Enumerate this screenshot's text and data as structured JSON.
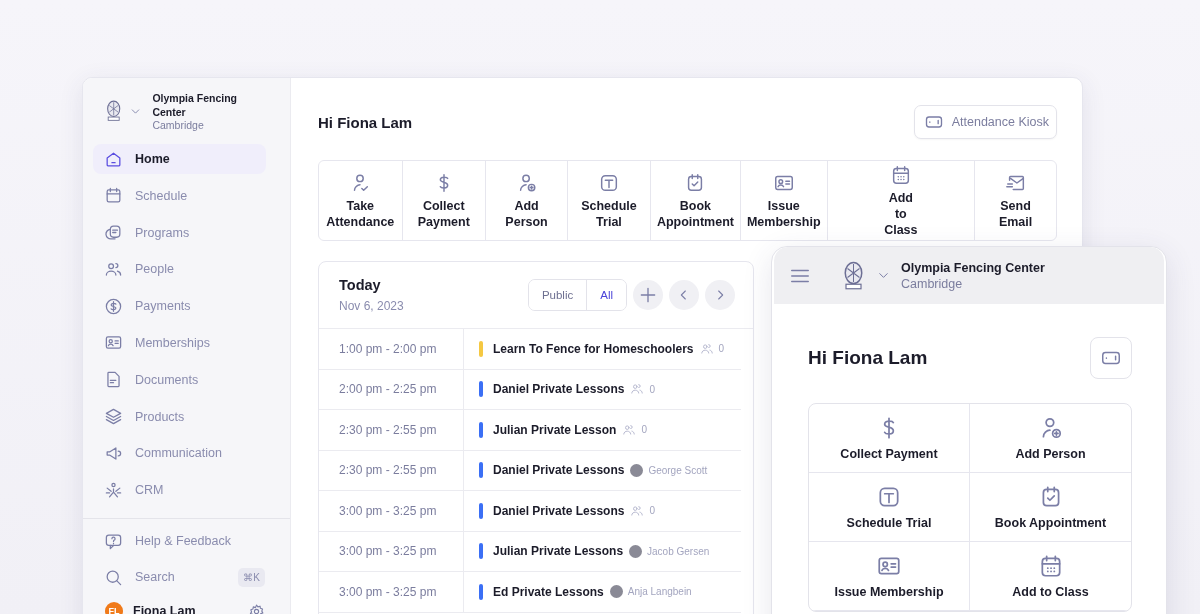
{
  "desktop": {
    "org": {
      "name": "Olympia Fencing Center",
      "location": "Cambridge"
    },
    "nav": [
      {
        "label": "Home",
        "selected": true
      },
      {
        "label": "Schedule",
        "selected": false
      },
      {
        "label": "Programs",
        "selected": false
      },
      {
        "label": "People",
        "selected": false
      },
      {
        "label": "Payments",
        "selected": false
      },
      {
        "label": "Memberships",
        "selected": false
      },
      {
        "label": "Documents",
        "selected": false
      },
      {
        "label": "Products",
        "selected": false
      },
      {
        "label": "Communication",
        "selected": false
      },
      {
        "label": "CRM",
        "selected": false
      }
    ],
    "footer_nav": [
      {
        "label": "Help & Feedback"
      },
      {
        "label": "Search",
        "shortcut": "⌘K"
      }
    ],
    "user": {
      "initials": "FL",
      "name": "Fiona Lam"
    },
    "greeting": "Hi Fiona Lam",
    "kiosk_button": "Attendance Kiosk",
    "actions": [
      {
        "label": "Take Attendance"
      },
      {
        "label": "Collect Payment"
      },
      {
        "label": "Add Person"
      },
      {
        "label": "Schedule Trial"
      },
      {
        "label": "Book Appointment"
      },
      {
        "label": "Issue Membership"
      },
      {
        "label": "Add to Class"
      },
      {
        "label": "Send Email"
      }
    ],
    "schedule": {
      "title": "Today",
      "date": "Nov 6, 2023",
      "filters": [
        {
          "label": "Public",
          "selected": false
        },
        {
          "label": "All",
          "selected": true
        }
      ],
      "events": [
        {
          "time": "1:00 pm - 2:00 pm",
          "title": "Learn To Fence for Homeschoolers",
          "color": "#f5c842",
          "kind": "attendees",
          "count": "0"
        },
        {
          "time": "2:00 pm - 2:25 pm",
          "title": "Daniel Private Lessons",
          "color": "#3b6ff5",
          "kind": "attendees",
          "count": "0"
        },
        {
          "time": "2:30 pm - 2:55 pm",
          "title": "Julian Private Lesson",
          "color": "#3b6ff5",
          "kind": "attendees",
          "count": "0"
        },
        {
          "time": "2:30 pm - 2:55 pm",
          "title": "Daniel Private Lessons",
          "color": "#3b6ff5",
          "kind": "instructor",
          "person": "George Scott"
        },
        {
          "time": "3:00 pm - 3:25 pm",
          "title": "Daniel Private Lessons",
          "color": "#3b6ff5",
          "kind": "attendees",
          "count": "0"
        },
        {
          "time": "3:00 pm - 3:25 pm",
          "title": "Julian Private Lessons",
          "color": "#3b6ff5",
          "kind": "instructor",
          "person": "Jacob Gersen"
        },
        {
          "time": "3:00 pm - 3:25 pm",
          "title": "Ed Private Lessons",
          "color": "#3b6ff5",
          "kind": "instructor",
          "person": "Anja Langbein"
        }
      ]
    }
  },
  "mobile": {
    "org": {
      "name": "Olympia Fencing Center",
      "location": "Cambridge"
    },
    "greeting": "Hi Fiona Lam",
    "actions": [
      {
        "label": "Collect Payment"
      },
      {
        "label": "Add Person"
      },
      {
        "label": "Schedule Trial"
      },
      {
        "label": "Book Appointment"
      },
      {
        "label": "Issue Membership"
      },
      {
        "label": "Add to Class"
      }
    ]
  }
}
